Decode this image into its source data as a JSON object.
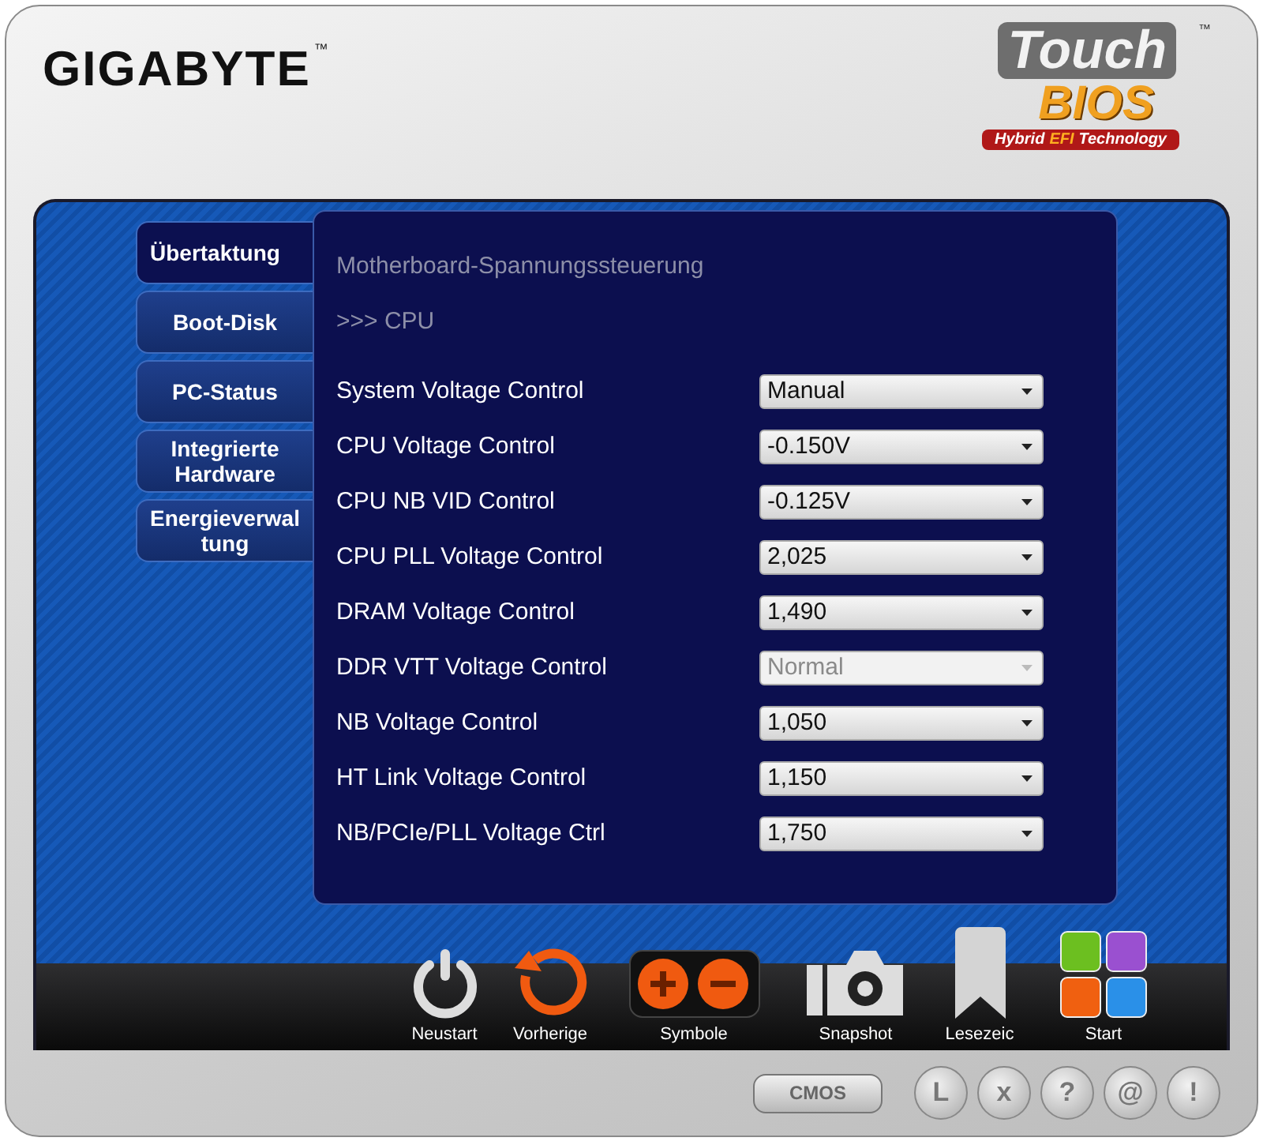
{
  "brand": {
    "name": "GIGABYTE",
    "trademark": "™"
  },
  "badge": {
    "touch": "Touch",
    "bios": "BIOS",
    "trademark": "™",
    "tagline": [
      "Hybrid",
      "EFI",
      "Technology"
    ]
  },
  "tabs": [
    {
      "label": "Übertaktung",
      "selected": true
    },
    {
      "label": "Boot-Disk",
      "selected": false
    },
    {
      "label": "PC-Status",
      "selected": false
    },
    {
      "label": "Integrierte Hardware",
      "selected": false
    },
    {
      "label": "Energieverwal tung",
      "selected": false
    }
  ],
  "panel": {
    "title": "Motherboard-Spannungssteuerung",
    "subtitle": ">>> CPU",
    "rows": [
      {
        "label": "System Voltage Control",
        "value": "Manual",
        "disabled": false
      },
      {
        "label": "CPU Voltage Control",
        "value": "-0.150V",
        "disabled": false
      },
      {
        "label": "CPU NB VID Control",
        "value": "-0.125V",
        "disabled": false
      },
      {
        "label": "CPU PLL Voltage Control",
        "value": "2,025",
        "disabled": false
      },
      {
        "label": "DRAM Voltage Control",
        "value": "1,490",
        "disabled": false
      },
      {
        "label": "DDR VTT Voltage Control",
        "value": "Normal",
        "disabled": true
      },
      {
        "label": "NB Voltage Control",
        "value": "1,050",
        "disabled": false
      },
      {
        "label": "HT Link Voltage Control",
        "value": "1,150",
        "disabled": false
      },
      {
        "label": "NB/PCIe/PLL Voltage Ctrl",
        "value": "1,750",
        "disabled": false
      }
    ]
  },
  "dock": [
    {
      "kind": "power",
      "label": "Neustart"
    },
    {
      "kind": "refresh",
      "label": "Vorherige"
    },
    {
      "kind": "plusminus",
      "label": "Symbole"
    },
    {
      "kind": "camera",
      "label": "Snapshot"
    },
    {
      "kind": "bookmark",
      "label": "Lesezeic"
    },
    {
      "kind": "tiles",
      "label": "Start"
    }
  ],
  "bottom_buttons": [
    {
      "kind": "pill",
      "label": "CMOS"
    },
    {
      "kind": "round",
      "label": "L"
    },
    {
      "kind": "round",
      "label": "x"
    },
    {
      "kind": "round",
      "label": "?"
    },
    {
      "kind": "round",
      "label": "@"
    },
    {
      "kind": "round",
      "label": "!"
    }
  ]
}
